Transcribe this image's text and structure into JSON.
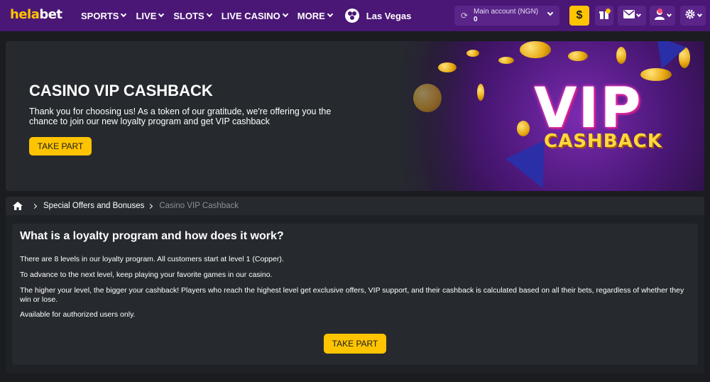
{
  "header": {
    "logo_hela": "hela",
    "logo_bet": "bet",
    "nav": [
      {
        "label": "SPORTS"
      },
      {
        "label": "LIVE"
      },
      {
        "label": "SLOTS"
      },
      {
        "label": "LIVE CASINO"
      },
      {
        "label": "MORE"
      }
    ],
    "las_vegas": "Las Vegas",
    "account_label": "Main account (NGN)",
    "account_balance": "0",
    "deposit_symbol": "$"
  },
  "banner": {
    "title": "CASINO VIP CASHBACK",
    "description": "Thank you for choosing us! As a token of our gratitude, we're offering you the chance to join our new loyalty program and get VIP cashback",
    "button": "TAKE PART",
    "art_vip": "VIP",
    "art_cashback": "CASHBACK"
  },
  "breadcrumb": {
    "level1": "Special Offers and Bonuses",
    "current": "Casino VIP Cashback"
  },
  "content": {
    "heading": "What is a loyalty program and how does it work?",
    "p1": "There are 8 levels in our loyalty program. All customers start at level 1 (Copper).",
    "p2": "To advance to the next level, keep playing your favorite games in our casino.",
    "p3": "The higher your level, the bigger your cashback! Players who reach the highest level get exclusive offers, VIP support, and their cashback is calculated based on all their bets, regardless of whether they win or lose.",
    "p4": "Available for authorized users only.",
    "button": "TAKE PART"
  },
  "colors": {
    "header_bg": "#4a1776",
    "accent": "#ffc400",
    "panel": "#262a2f",
    "page_bg": "#1a1c1f"
  }
}
